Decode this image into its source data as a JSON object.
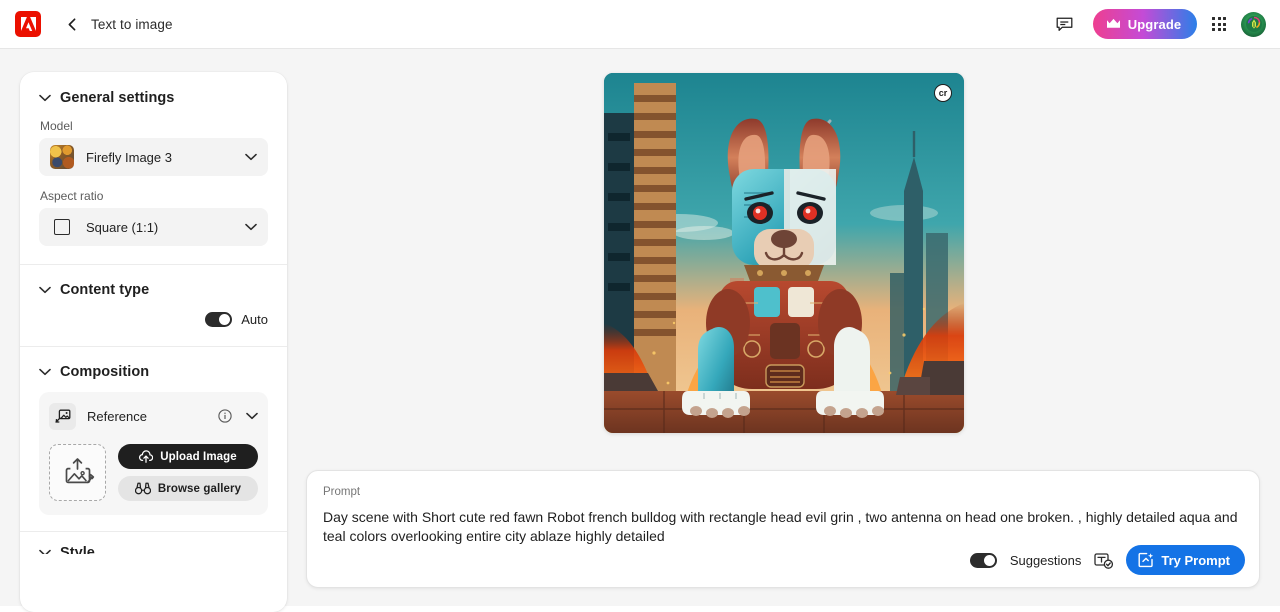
{
  "header": {
    "app_logo": "adobe-logo",
    "back_icon": "chevron-left-icon",
    "title": "Text to image",
    "feedback_icon": "speech-bubble-icon",
    "upgrade_label": "Upgrade",
    "upgrade_icon": "crown-icon",
    "app_grid_icon": "app-grid-icon",
    "avatar_icon": "user-avatar"
  },
  "sidebar": {
    "general_settings": {
      "title": "General settings",
      "collapse_icon": "chevron-down-icon",
      "model_label": "Model",
      "model_value": "Firefly Image 3",
      "model_thumb_icon": "model-thumbnail",
      "aspect_ratio_label": "Aspect ratio",
      "aspect_ratio_value": "Square (1:1)",
      "aspect_ratio_icon": "square-icon",
      "dropdown_icon": "chevron-down-icon"
    },
    "content_type": {
      "title": "Content type",
      "collapse_icon": "chevron-down-icon",
      "auto_label": "Auto",
      "auto_enabled": true
    },
    "composition": {
      "title": "Composition",
      "collapse_icon": "chevron-down-icon",
      "reference_label": "Reference",
      "reference_icon": "image-reference-icon",
      "info_icon": "info-icon",
      "expand_icon": "chevron-down-icon",
      "dropzone_icon": "upload-image-placeholder-icon",
      "upload_label": "Upload Image",
      "upload_icon": "cloud-upload-icon",
      "browse_label": "Browse gallery",
      "browse_icon": "binoculars-icon"
    },
    "style": {
      "title": "Style",
      "collapse_icon": "chevron-down-icon"
    }
  },
  "canvas": {
    "image_alt": "Robotic red fawn French bulldog with teal and aqua armor sitting in a city ablaze",
    "content_credentials_badge": "cr"
  },
  "prompt": {
    "label": "Prompt",
    "value": "Day scene with Short cute red fawn Robot french bulldog with rectangle head evil grin , two antenna on head one broken. , highly detailed aqua and teal colors overlooking entire city ablaze highly detailed",
    "suggestions_label": "Suggestions",
    "suggestions_enabled": true,
    "text_check_icon": "text-check-icon",
    "try_prompt_label": "Try Prompt",
    "try_prompt_icon": "sparkle-send-icon"
  },
  "colors": {
    "accent_blue": "#1473e6",
    "adobe_red": "#eb1000",
    "dark": "#1f1f1f",
    "canvas_bg": "#f5f5f5"
  }
}
